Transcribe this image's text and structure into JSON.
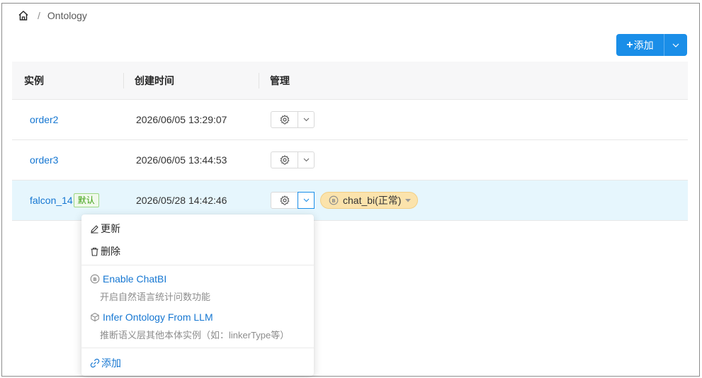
{
  "breadcrumb": {
    "home_icon": "home-icon",
    "separator": "/",
    "current": "Ontology"
  },
  "toolbar": {
    "add_label": "添加",
    "add_plus": "+"
  },
  "table": {
    "columns": [
      "实例",
      "创建时间",
      "管理"
    ],
    "rows": [
      {
        "name": "order2",
        "created": "2026/06/05 13:29:07",
        "badge": "",
        "status": ""
      },
      {
        "name": "order3",
        "created": "2026/06/05 13:44:53",
        "badge": "",
        "status": ""
      },
      {
        "name": "falcon_14",
        "created": "2026/05/28 14:42:46",
        "badge": "默认",
        "status": "chat_bi(正常)"
      }
    ]
  },
  "menu": {
    "update_label": "更新",
    "delete_label": "删除",
    "enable_chatbi": {
      "title": "Enable ChatBI",
      "desc": "开启自然语言统计问数功能"
    },
    "infer_ontology": {
      "title": "Infer Ontology From LLM",
      "desc": "推断语义层其他本体实例（如：linkerType等）"
    },
    "add_label": "添加"
  },
  "colors": {
    "primary": "#1a8ee8",
    "link": "#1677d2",
    "selected_row": "#e6f6fd",
    "status_pill": "#fbe3ac",
    "badge_green": "#389e0d"
  }
}
